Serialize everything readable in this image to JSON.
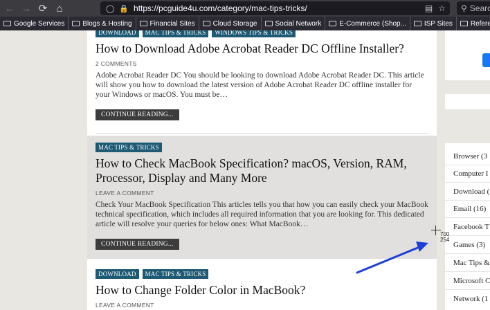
{
  "browser": {
    "url": "https://pcguide4u.com/category/mac-tips-tricks/",
    "search_placeholder": "Search"
  },
  "bookmarks": [
    {
      "label": "Google Services",
      "icon": "folder-icon"
    },
    {
      "label": "Blogs & Hosting",
      "icon": "folder-icon"
    },
    {
      "label": "Financial Sites",
      "icon": "folder-icon"
    },
    {
      "label": "Cloud Storage",
      "icon": "folder-icon"
    },
    {
      "label": "Social Network",
      "icon": "folder-icon"
    },
    {
      "label": "E-Commerce (Shop...",
      "icon": "folder-icon"
    },
    {
      "label": "ISP Sites",
      "icon": "folder-icon"
    },
    {
      "label": "Reference Sites",
      "icon": "folder-icon"
    }
  ],
  "articles": [
    {
      "tags": [
        "DOWNLOAD",
        "MAC TIPS & TRICKS",
        "WINDOWS TIPS & TRICKS"
      ],
      "title": "How to Download Adobe Acrobat Reader DC Offline Installer?",
      "meta": "2 COMMENTS",
      "excerpt": "Adobe Acrobat Reader DC You should be looking to download Adobe Acrobat Reader DC. This article will show you how to download the latest version of Adobe Acrobat Reader DC offline installer for your Windows or macOS. You must be…",
      "button": "CONTINUE READING..."
    },
    {
      "tags": [
        "MAC TIPS & TRICKS"
      ],
      "title": "How to Check MacBook Specification? macOS, Version, RAM, Processor, Display and Many More",
      "meta": "LEAVE A COMMENT",
      "excerpt": "Check Your MacBook Specification This articles tells you that how you can easily check your MacBook technical specification, which includes all required information that you are looking for. This dedicated article will resolve your queries for below ones: What MacBook…",
      "button": "CONTINUE READING..."
    },
    {
      "tags": [
        "DOWNLOAD",
        "MAC TIPS & TRICKS"
      ],
      "title": "How to Change Folder Color in MacBook?",
      "meta": "LEAVE A COMMENT"
    }
  ],
  "categories": [
    "Browser (3",
    "Computer I",
    "Download (",
    "Email (16)",
    "Facebook T",
    "Games (3)",
    "Mac Tips &",
    "Microsoft C",
    "Network (1"
  ],
  "cursor": {
    "x_label": "700",
    "y_label": "254"
  },
  "colors": {
    "tag": "#1f5a75",
    "annotation_arrow": "#1d3fd6"
  }
}
